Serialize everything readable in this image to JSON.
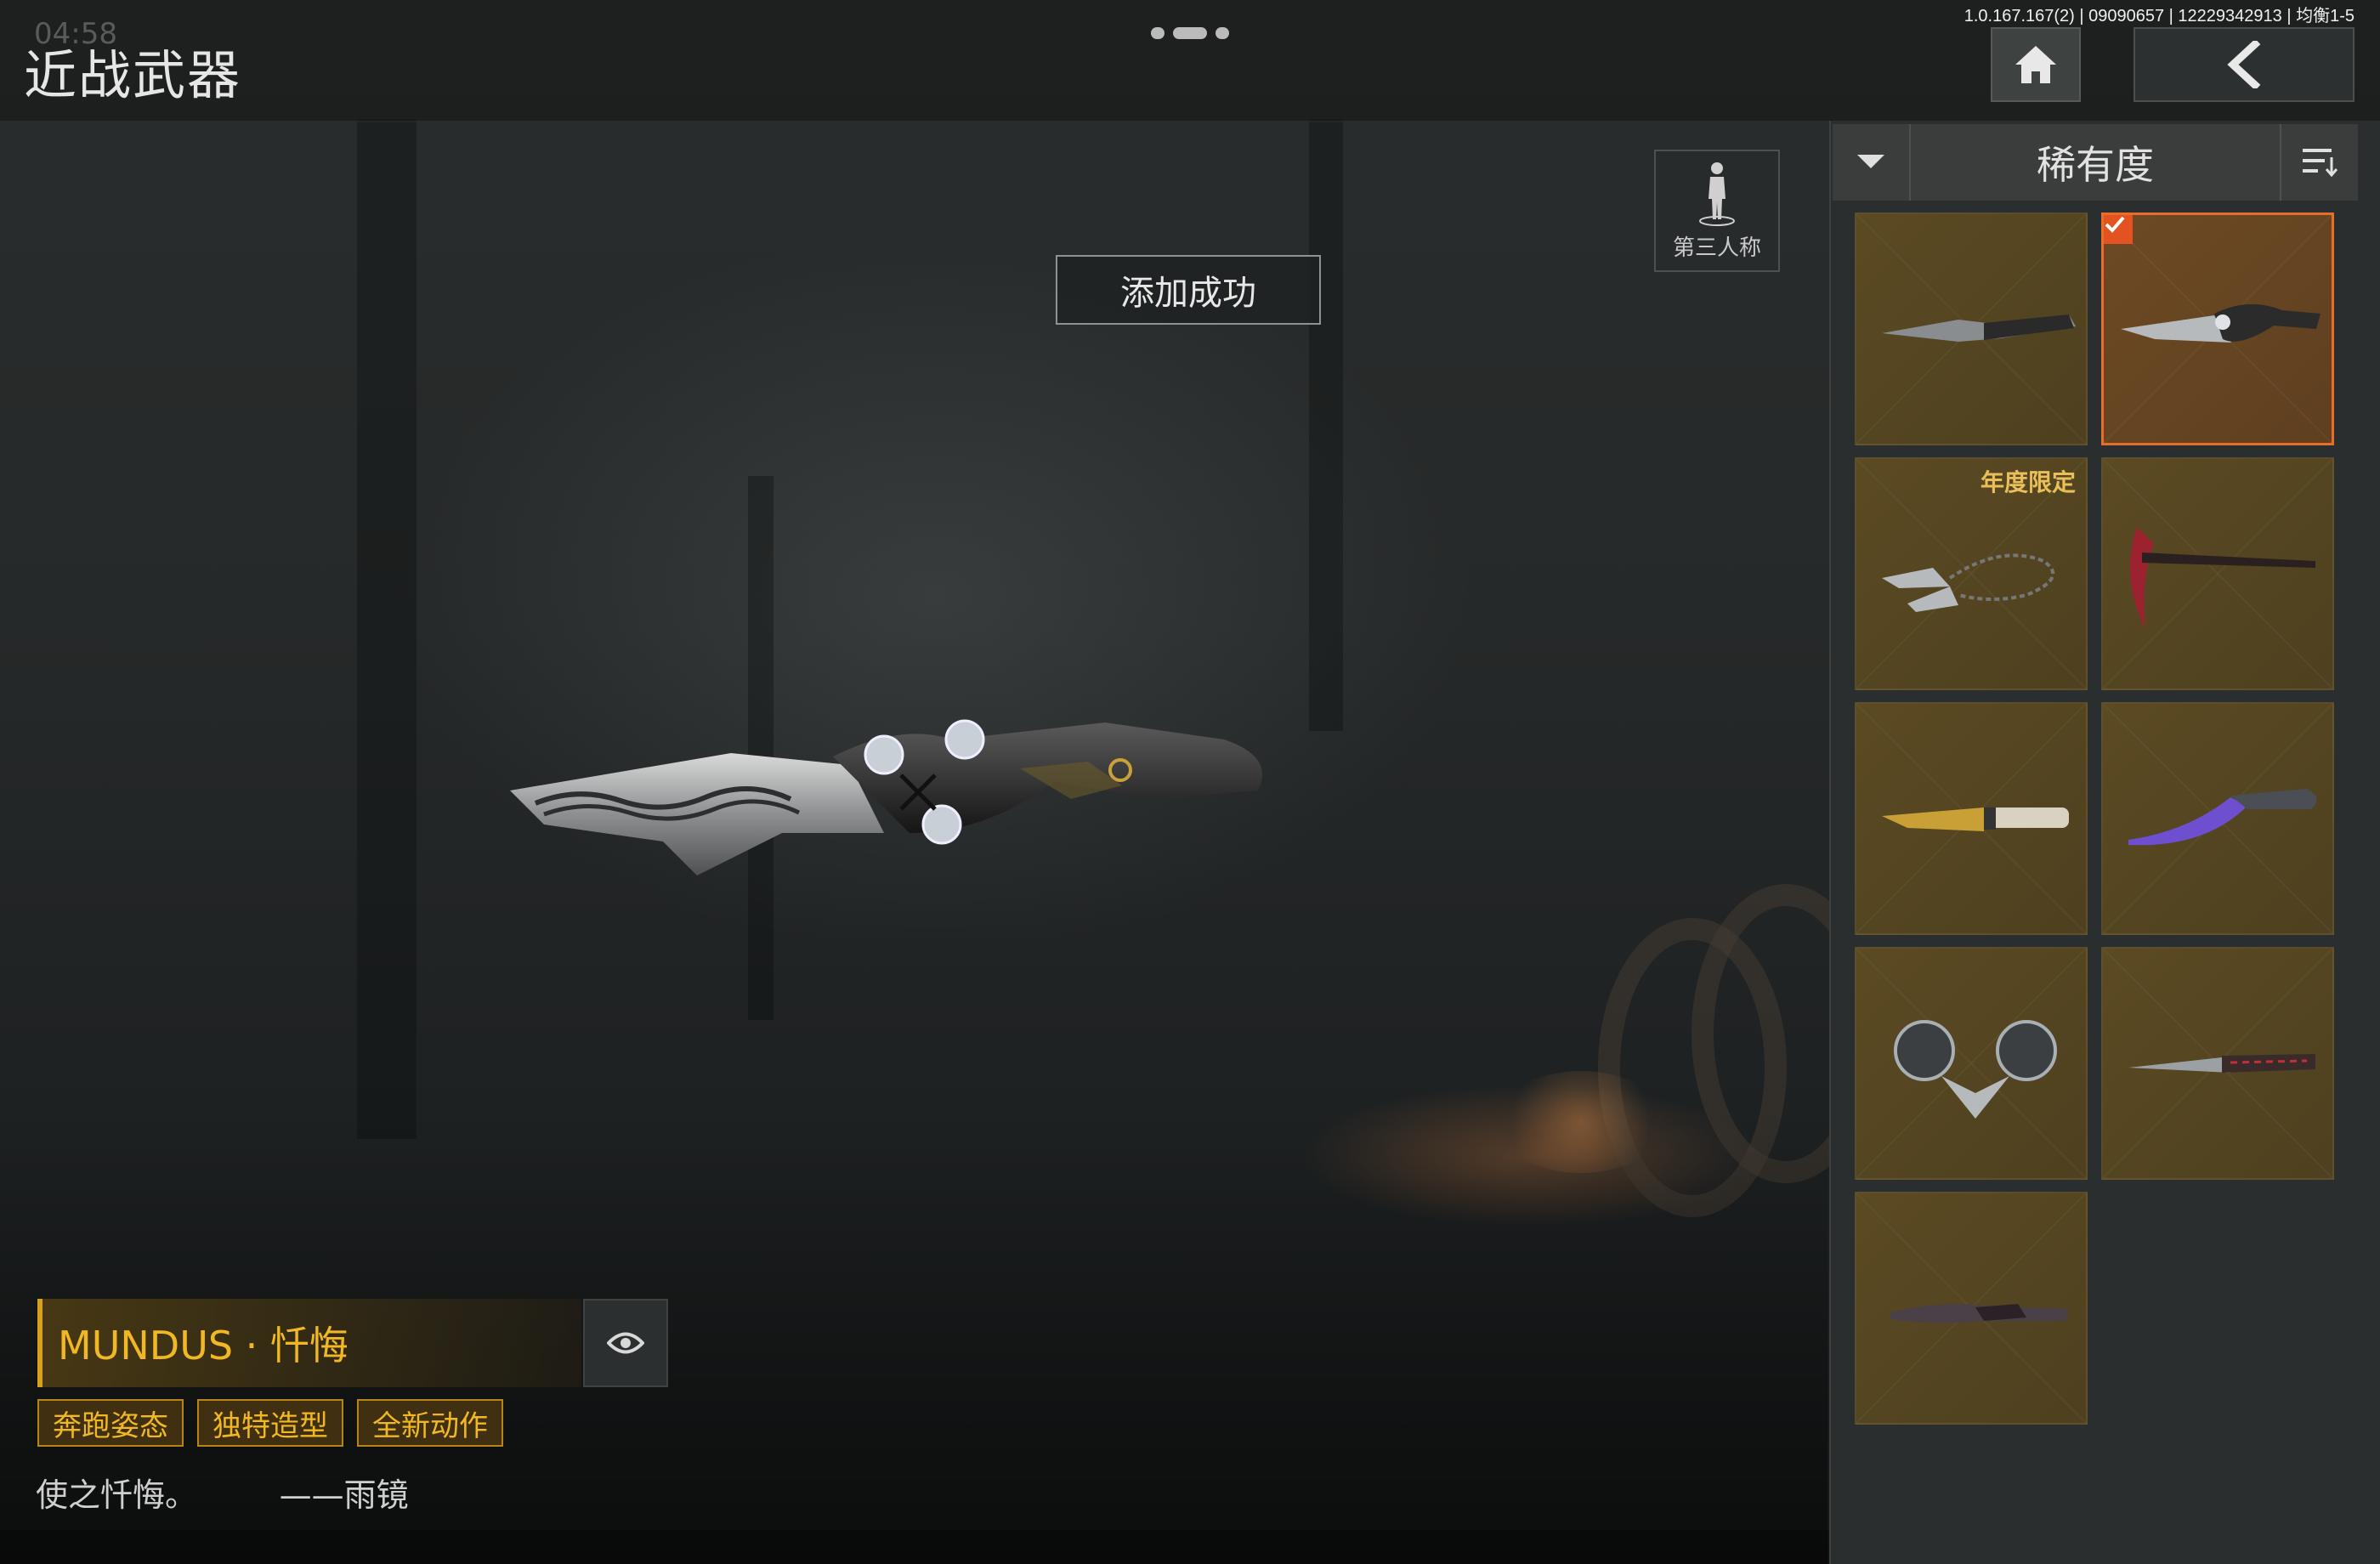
{
  "header": {
    "title": "近战武器",
    "clock": "04:58",
    "version_info": "1.0.167.167(2) | 09090657 | 12229342913 | 均衡1-5",
    "status_icons": "☾ ≋ ⚬"
  },
  "view_toggle": {
    "label": "第三人称",
    "icon": "person-icon"
  },
  "toast": {
    "message": "添加成功"
  },
  "sort": {
    "label": "稀有度"
  },
  "weapon_info": {
    "name": "MUNDUS · 忏悔",
    "tags": [
      "奔跑姿态",
      "独特造型",
      "全新动作"
    ],
    "quote": "使之忏悔。        ——雨镜"
  },
  "inventory": [
    {
      "id": "knife-1",
      "selected": false,
      "badge": ""
    },
    {
      "id": "knife-2",
      "selected": true,
      "badge": ""
    },
    {
      "id": "knife-3",
      "selected": false,
      "badge": "年度限定"
    },
    {
      "id": "knife-4",
      "selected": false,
      "badge": ""
    },
    {
      "id": "knife-5",
      "selected": false,
      "badge": ""
    },
    {
      "id": "knife-6",
      "selected": false,
      "badge": ""
    },
    {
      "id": "knife-7",
      "selected": false,
      "badge": ""
    },
    {
      "id": "knife-8",
      "selected": false,
      "badge": ""
    },
    {
      "id": "knife-9",
      "selected": false,
      "badge": ""
    }
  ],
  "colors": {
    "accent_gold": "#f1b824",
    "selected_border": "#e86d2a",
    "check_bg": "#e3531f",
    "card_bg": "#5b4a22"
  }
}
